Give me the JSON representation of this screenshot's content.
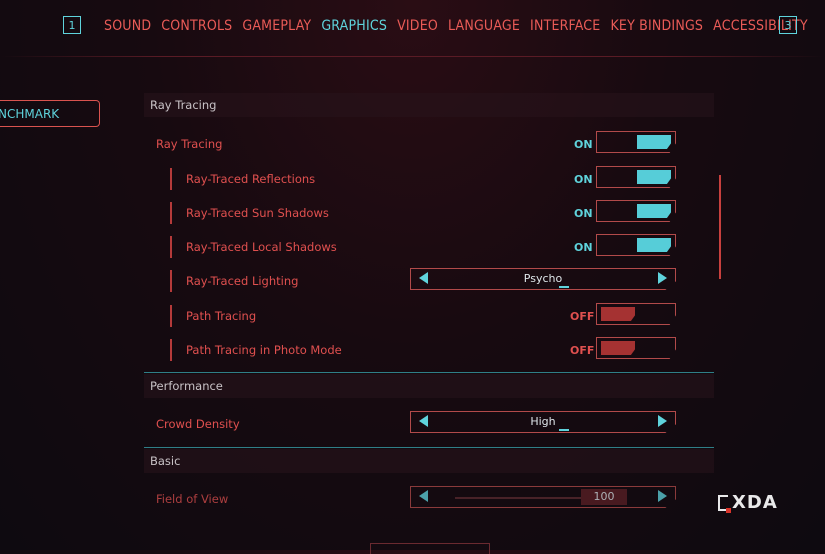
{
  "nav": {
    "left_key": "1",
    "right_key": "3",
    "tabs": [
      {
        "label": "SOUND",
        "active": false
      },
      {
        "label": "CONTROLS",
        "active": false
      },
      {
        "label": "GAMEPLAY",
        "active": false
      },
      {
        "label": "GRAPHICS",
        "active": true
      },
      {
        "label": "VIDEO",
        "active": false
      },
      {
        "label": "LANGUAGE",
        "active": false
      },
      {
        "label": "INTERFACE",
        "active": false
      },
      {
        "label": "KEY BINDINGS",
        "active": false
      },
      {
        "label": "ACCESSIBILITY",
        "active": false
      }
    ]
  },
  "side": {
    "benchmark_label": "NCHMARK"
  },
  "sections": {
    "ray_tracing": "Ray Tracing",
    "performance": "Performance",
    "basic": "Basic"
  },
  "settings": {
    "ray_tracing": {
      "label": "Ray Tracing",
      "state": "ON"
    },
    "rt_reflections": {
      "label": "Ray-Traced Reflections",
      "state": "ON"
    },
    "rt_sun_shadows": {
      "label": "Ray-Traced Sun Shadows",
      "state": "ON"
    },
    "rt_local_shadows": {
      "label": "Ray-Traced Local Shadows",
      "state": "ON"
    },
    "rt_lighting": {
      "label": "Ray-Traced Lighting",
      "value": "Psycho"
    },
    "path_tracing": {
      "label": "Path Tracing",
      "state": "OFF"
    },
    "path_tracing_photo": {
      "label": "Path Tracing in Photo Mode",
      "state": "OFF"
    },
    "crowd_density": {
      "label": "Crowd Density",
      "value": "High"
    },
    "field_of_view": {
      "label": "Field of View",
      "value": "100"
    }
  },
  "watermark": {
    "text": "XDA"
  },
  "colors": {
    "accent_cyan": "#5fd3dc",
    "accent_red": "#e0504f",
    "background": "#170a10"
  }
}
